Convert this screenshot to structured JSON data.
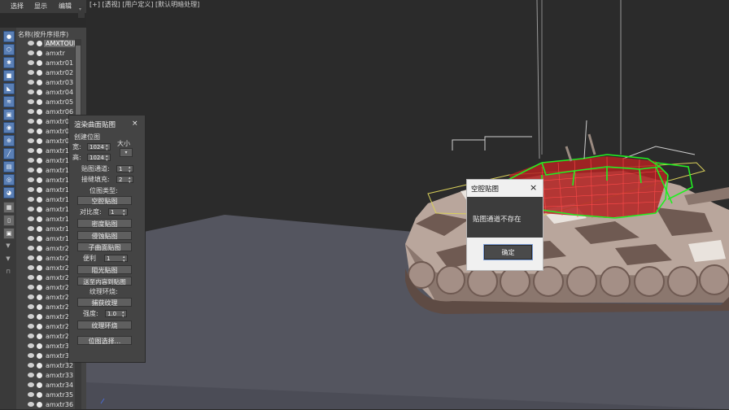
{
  "menu": {
    "items": [
      "选择",
      "显示",
      "编辑"
    ]
  },
  "toolbar": {
    "icons": [
      "sphere-icon",
      "shapes-icon",
      "light-icon",
      "camera-icon",
      "helper-icon",
      "spacewarp-icon",
      "group-icon",
      "xref-icon",
      "container-icon",
      "bone-icon",
      "frozen-icon",
      "hidden-icon",
      "eye-icon",
      "layer-icon",
      "page-icon",
      "settings-icon",
      "filter-icon",
      "funnel-icon",
      "lock-icon"
    ]
  },
  "explorer": {
    "header": "名称(按升序排序)",
    "items": [
      "AMXTOUR",
      "amxtr",
      "amxtr01",
      "amxtr02",
      "amxtr03",
      "amxtr04",
      "amxtr05",
      "amxtr06",
      "amxtr07",
      "amxtr08",
      "amxtr09",
      "amxtr10",
      "amxtr11",
      "amxtr12",
      "amxtr13",
      "amxtr14",
      "amxtr15",
      "amxtr16",
      "amxtr17",
      "amxtr18",
      "amxtr19",
      "amxtr20",
      "amxtr21",
      "amxtr22",
      "amxtr23",
      "amxtr24",
      "amxtr25",
      "amxtr26",
      "amxtr27",
      "amxtr28",
      "amxtr29",
      "amxtr30",
      "amxtr31",
      "amxtr32",
      "amxtr33",
      "amxtr34",
      "amxtr35",
      "amxtr36"
    ]
  },
  "viewport": {
    "label": "[+] [透视] [用户定义] [默认明暗处理]"
  },
  "render_panel": {
    "title": "渲染曲面贴图",
    "close": "×",
    "create_label": "创建位图",
    "width_label": "宽:",
    "width_value": "1024",
    "height_label": "高:",
    "height_value": "1024",
    "size_label": "大小",
    "dropdown_arrow": "▾",
    "map_channel_label": "贴图通道:",
    "map_channel_value": "1",
    "seam_fill_label": "接缝填充:",
    "seam_fill_value": "2",
    "bitmap_type_label": "位图类型:",
    "btn_cavity": "空腔贴图",
    "ratio_label": "对比度:",
    "ratio_value": "1",
    "btn_density": "密度贴图",
    "btn_dust": "侵蚀贴图",
    "btn_subsurface": "子曲面贴图",
    "radius_label": "便利",
    "radius_value": "1",
    "btn_shadow": "阻光贴图",
    "btn_project": "送至内容到贴图",
    "texture_label": "纹理环烧:",
    "btn_capture": "捕获纹理",
    "strength_label": "强度:",
    "strength_value": "1.0",
    "btn_bake": "纹理环烧",
    "btn_bitmap_select": "位图选择..."
  },
  "dialog": {
    "title": "空腔贴图",
    "close": "×",
    "message": "贴图通道不存在",
    "ok": "确定"
  },
  "colors": {
    "wire_red": "#cc2222",
    "wire_green": "#22dd22",
    "floor": "#545560",
    "tank_base": "#b8a49a"
  }
}
